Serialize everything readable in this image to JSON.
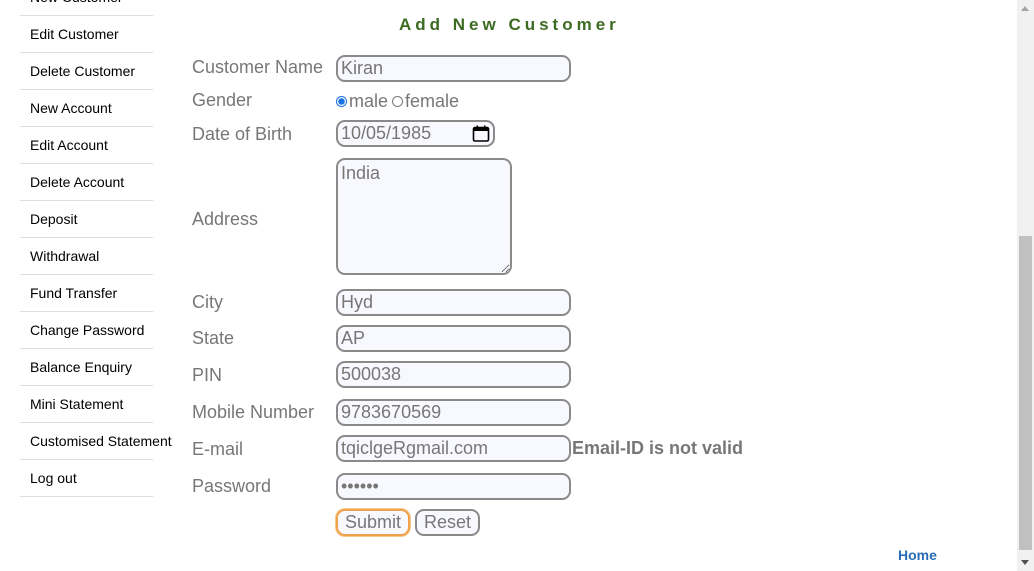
{
  "sidebar": {
    "items": [
      {
        "label": "New Customer"
      },
      {
        "label": "Edit Customer"
      },
      {
        "label": "Delete Customer"
      },
      {
        "label": "New Account"
      },
      {
        "label": "Edit Account"
      },
      {
        "label": "Delete Account"
      },
      {
        "label": "Deposit"
      },
      {
        "label": "Withdrawal"
      },
      {
        "label": "Fund Transfer"
      },
      {
        "label": "Change Password"
      },
      {
        "label": "Balance Enquiry"
      },
      {
        "label": "Mini Statement"
      },
      {
        "label": "Customised Statement"
      },
      {
        "label": "Log out"
      }
    ]
  },
  "form": {
    "title": "Add New Customer",
    "labels": {
      "customer_name": "Customer Name",
      "gender": "Gender",
      "dob": "Date of Birth",
      "address": "Address",
      "city": "City",
      "state": "State",
      "pin": "PIN",
      "mobile": "Mobile Number",
      "email": "E-mail",
      "password": "Password"
    },
    "values": {
      "customer_name": "Kiran",
      "dob": "10/05/1985",
      "address": "India",
      "city": "Hyd",
      "state": "AP",
      "pin": "500038",
      "mobile": "9783670569",
      "email": "tqiclgeRgmail.com",
      "password": "••••••"
    },
    "gender_options": {
      "male": "male",
      "female": "female",
      "selected": "male"
    },
    "email_error": "Email-ID is not valid",
    "submit_label": "Submit",
    "reset_label": "Reset"
  },
  "footer": {
    "home_label": "Home"
  },
  "colors": {
    "title": "#3c6b22",
    "link": "#2a6fb5",
    "field_bg": "#f8f8ff",
    "submit_focus": "#f0a24a"
  },
  "icons": {
    "calendar": "calendar-icon",
    "resize": "resize-handle-icon"
  }
}
